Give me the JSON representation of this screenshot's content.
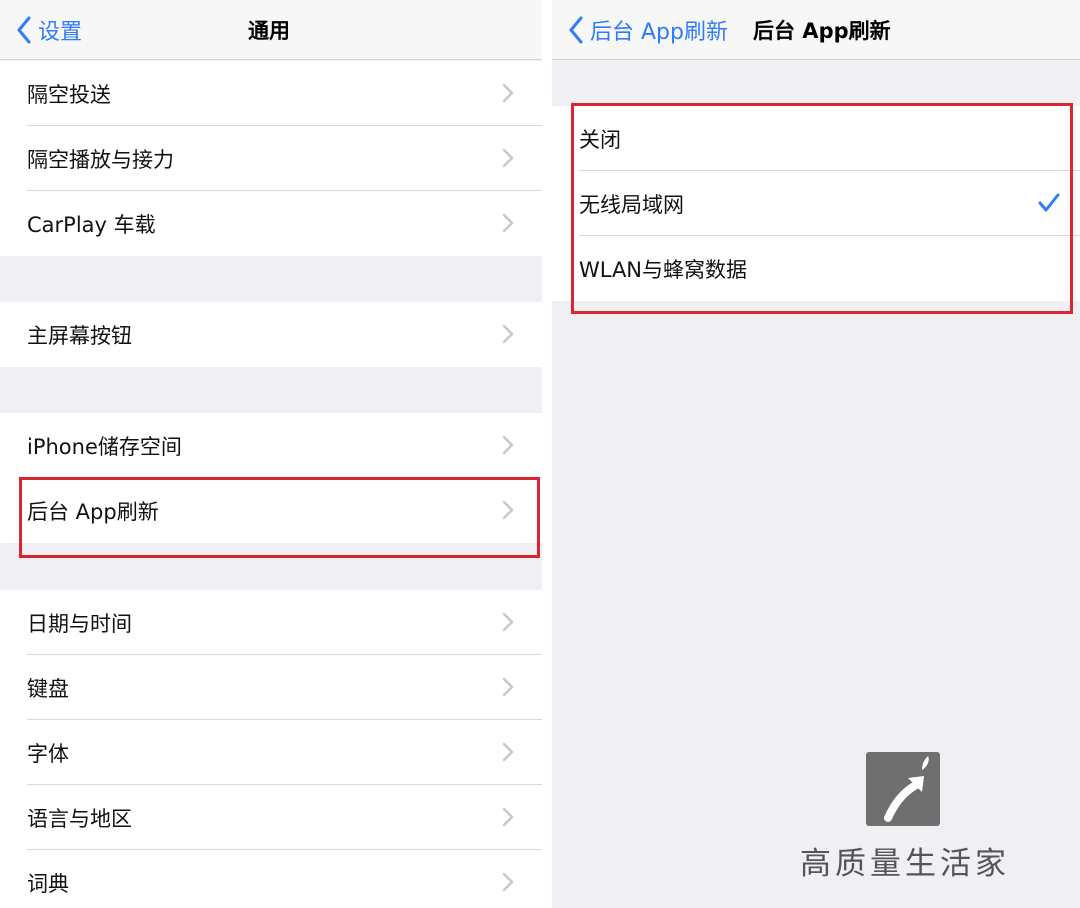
{
  "left_screen": {
    "back_label": "设置",
    "title": "通用",
    "groups": [
      [
        "隔空投送",
        "隔空播放与接力",
        "CarPlay 车载"
      ],
      [
        "主屏幕按钮"
      ],
      [
        "iPhone储存空间",
        "后台 App刷新"
      ],
      [
        "日期与时间",
        "键盘",
        "字体",
        "语言与地区",
        "词典"
      ]
    ]
  },
  "right_screen": {
    "back_label": "后台 App刷新",
    "title": "后台 App刷新",
    "options": [
      "关闭",
      "无线局域网",
      "WLAN与蜂窝数据"
    ],
    "selected_index": 1
  },
  "watermark": {
    "text": "高质量生活家"
  },
  "colors": {
    "accent": "#2f7cf6",
    "highlight": "#d9262f",
    "background": "#efeff4"
  }
}
